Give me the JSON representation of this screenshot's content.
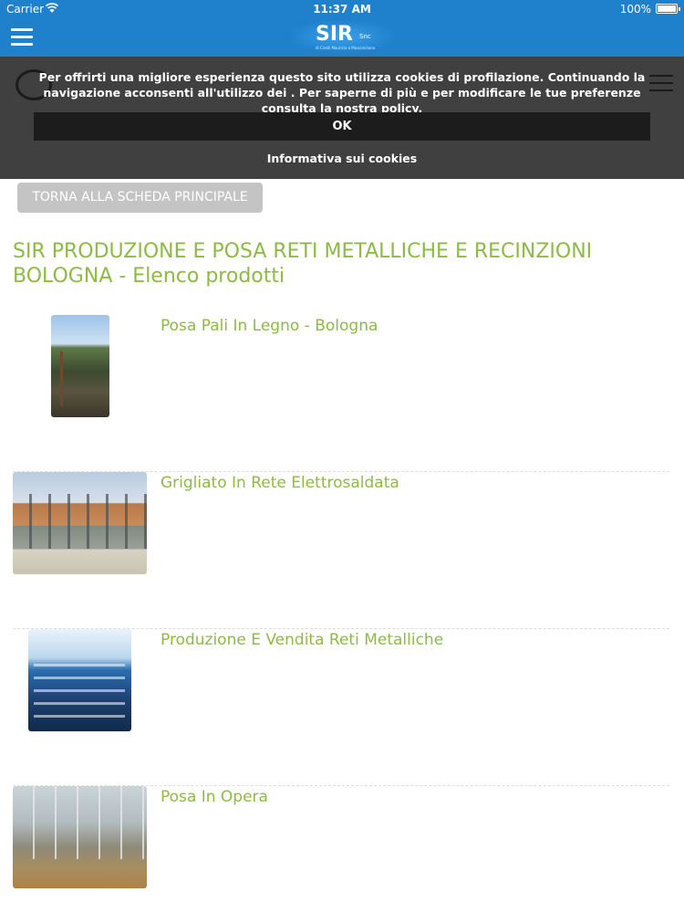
{
  "status_bar": {
    "carrier": "Carrier",
    "time": "11:37 AM",
    "battery": "100%"
  },
  "header": {
    "logo_text": "SIR",
    "logo_suffix": "Snc",
    "logo_tagline": "di Cirelli Maurizio e Massimiliano",
    "background_color": "#1f80cc"
  },
  "cookie_banner": {
    "message": "Per offrirti una migliore esperienza questo sito utilizza cookies di profilazione. Continuando la navigazione acconsenti all'utilizzo dei . Per saperne di più e per modificare le tue preferenze consulta la nostra policy.",
    "ok_label": "OK",
    "info_label": "Informativa sui cookies"
  },
  "back_button_label": "TORNA ALLA SCHEDA PRINCIPALE",
  "page_title": "SIR PRODUZIONE E POSA RETI METALLICHE E RECINZIONI BOLOGNA - Elenco prodotti",
  "accent_color": "#8dba44",
  "products": [
    {
      "name": "Posa Pali In Legno - Bologna"
    },
    {
      "name": "Grigliato In Rete Elettrosaldata"
    },
    {
      "name": "Produzione E Vendita Reti Metalliche"
    },
    {
      "name": "Posa In Opera"
    }
  ]
}
